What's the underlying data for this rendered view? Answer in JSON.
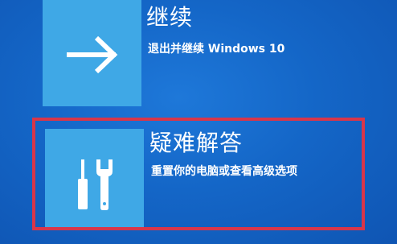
{
  "options": [
    {
      "title": "继续",
      "description": "退出并继续 Windows 10",
      "icon": "arrow-right-icon"
    },
    {
      "title": "疑难解答",
      "description": "重置你的电脑或查看高级选项",
      "icon": "tools-icon"
    }
  ],
  "colors": {
    "background": "#1466c7",
    "tile": "#3fa8e6",
    "highlight": "#d8364a",
    "text": "#ffffff"
  }
}
